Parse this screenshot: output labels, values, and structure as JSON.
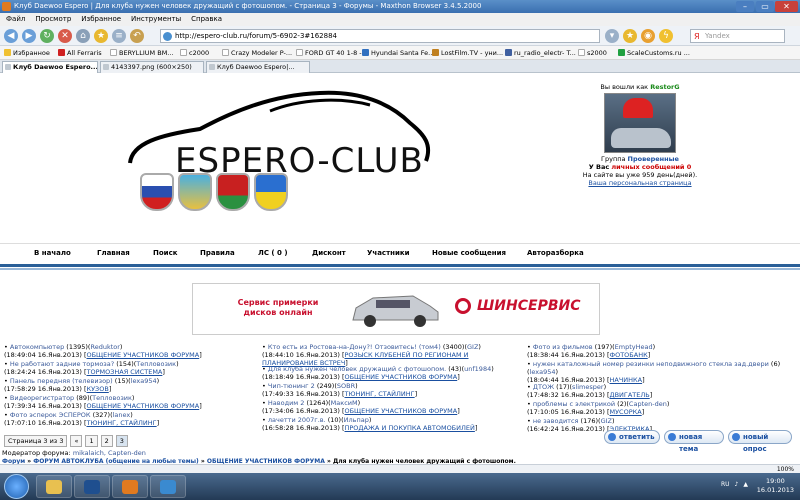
{
  "window": {
    "title": "Клуб Daewoo Espero | Для клуба нужен человек дружащий с фотошопом. - Страница 3 - Форумы - Maxthon Browser 3.4.5.2000"
  },
  "menu": [
    "Файл",
    "Просмотр",
    "Избранное",
    "Инструменты",
    "Справка"
  ],
  "navbar": {
    "url": "http://espero-club.ru/forum/5-6902-3#162884",
    "search_placeholder": "Yandex"
  },
  "bookmarks": [
    {
      "label": "Избранное",
      "color": "#f0c030"
    },
    {
      "label": "All Ferraris",
      "color": "#d02020"
    },
    {
      "label": "BERYLLIUM BM...",
      "color": "#ffffff"
    },
    {
      "label": "c2000",
      "color": "#ffffff"
    },
    {
      "label": "Crazy Modeler P-...",
      "color": "#ffffff"
    },
    {
      "label": "FORD GT 40 1-8 -...",
      "color": "#ffffff"
    },
    {
      "label": "Hyundai Santa Fe...",
      "color": "#3070c0"
    },
    {
      "label": "LostFilm.TV - уни...",
      "color": "#c08020"
    },
    {
      "label": "ru_radio_electr- T...",
      "color": "#4060a0"
    },
    {
      "label": "s2000",
      "color": "#ffffff"
    },
    {
      "label": "ScaleCustoms.ru ...",
      "color": "#20a040"
    }
  ],
  "tabs": [
    {
      "label": "Клуб Daewoo Espero...",
      "active": true
    },
    {
      "label": "4143397.png (600×250)",
      "active": false
    },
    {
      "label": "Клуб Daewoo Espero|...",
      "active": false
    }
  ],
  "logo": {
    "text": "ESPERO-CLUB"
  },
  "user": {
    "logged_in_as": "Вы вошли как",
    "username": "RestorG",
    "group_label": "Группа",
    "group": "Проверенные",
    "messages_prefix": "У Вас",
    "messages_link": "личных сообщений 0",
    "on_site": "На сайте вы уже 959 день(дней).",
    "personal_page": "Ваша персональная страница"
  },
  "mainnav": [
    "В начало",
    "Главная",
    "Поиск",
    "Правила",
    "ЛС ( 0 )",
    "Дисконт",
    "Участники",
    "Новые сообщения",
    "Авторазборка"
  ],
  "banner": {
    "left_line1": "Сервис примерки",
    "left_line2": "дисков онлайн",
    "brand": "ШИНСЕРВИС"
  },
  "forum_col1": [
    {
      "title": "Автокомпьютер",
      "count": "(1395)",
      "user": "Reduktor",
      "date": "(18:49:04 16.Янв.2013)",
      "section": "ОБЩЕНИЕ УЧАСТНИКОВ ФОРУМА"
    },
    {
      "title": "Не работают задние тормоза?",
      "count": "(154)",
      "user": "Тепловозик",
      "date": "(18:24:24 16.Янв.2013)",
      "section": "ТОРМОЗНАЯ СИСТЕМА"
    },
    {
      "title": "Панель передняя (телевизор)",
      "count": "(15)",
      "user": "lexa954",
      "date": "(17:58:29 16.Янв.2013)",
      "section": "КУЗОВ"
    },
    {
      "title": "Видеорегистратор",
      "count": "(89)",
      "user": "Тепловозик",
      "date": "(17:39:34 16.Янв.2013)",
      "section": "ОБЩЕНИЕ УЧАСТНИКОВ ФОРУМА"
    },
    {
      "title": "Фото эсперок ЭСПЕРОК",
      "count": "(327)",
      "user": "lanex",
      "date": "(17:07:10 16.Янв.2013)",
      "section": "ТЮНИНГ, СТАЙЛИНГ"
    }
  ],
  "forum_col2": [
    {
      "title": "Кто есть из Ростова-на-Дону?! Отзовитесь! (том4)",
      "count": "(3400)",
      "user": "GIZ",
      "date": "(18:44:10 16.Янв.2013)",
      "section": "РОЗЫСК КЛУБЕНЕЙ ПО РЕГИОНАМ И ПЛАНИРОВАНИЕ ВСТРЕЧ"
    },
    {
      "title": "Для клуба нужен человек дружащий с фотошопом.",
      "count": "(43)",
      "user": "unf1984",
      "date": "(18:18:49 16.Янв.2013)",
      "section": "ОБЩЕНИЕ УЧАСТНИКОВ ФОРУМА"
    },
    {
      "title": "Чип-тюнинг 2",
      "count": "(249)",
      "user": "SOBR",
      "date": "(17:49:33 16.Янв.2013)",
      "section": "ТЮНИНГ, СТАЙЛИНГ"
    },
    {
      "title": "Наводим 2",
      "count": "(1264)",
      "user": "МаксиМ",
      "date": "(17:34:06 16.Янв.2013)",
      "section": "ОБЩЕНИЕ УЧАСТНИКОВ ФОРУМА"
    },
    {
      "title": "лачетти 2007г.в.",
      "count": "(10)",
      "user": "Ильпар",
      "date": "(16:58:28 16.Янв.2013)",
      "section": "ПРОДАЖА И ПОКУПКА АВТОМОБИЛЕЙ"
    }
  ],
  "forum_col3": [
    {
      "title": "Фото из фильмов",
      "count": "(197)",
      "user": "EmptyHead",
      "date": "(18:38:44 16.Янв.2013)",
      "section": "ФОТОБАНК"
    },
    {
      "title": "нужен каталожный номер резинки неподвижного стекла зад.двери",
      "count": "(6)",
      "user": "lexa954",
      "date": "(18:04:44 16.Янв.2013)",
      "section": "НАЧИНКА"
    },
    {
      "title": "ДТОЖ",
      "count": "(17)",
      "user": "slimesper",
      "date": "(17:48:32 16.Янв.2013)",
      "section": "ДВИГАТЕЛЬ"
    },
    {
      "title": "проблемы с электрикой",
      "count": "(2)",
      "user": "Capten-den",
      "date": "(17:10:05 16.Янв.2013)",
      "section": "МУСОРКА"
    },
    {
      "title": "не заводится",
      "count": "(176)",
      "user": "GIZ",
      "date": "(16:42:24 16.Янв.2013)",
      "section": "ЭЛЕКТРИКА"
    }
  ],
  "pager": {
    "label": "Страница 3 из 3",
    "prev": "«",
    "pages": [
      "1",
      "2",
      "3"
    ]
  },
  "actions": {
    "reply": "ответить",
    "new_topic": "новая тема",
    "new_poll": "новый опрос"
  },
  "moderators": {
    "label": "Модератор форума:",
    "names": "mikalaich, Capten-den"
  },
  "breadcrumbs": {
    "forum": "Форум",
    "club": "ФОРУМ АВТОКЛУБА (общение на любые темы)",
    "section": "ОБЩЕНИЕ УЧАСТНИКОВ ФОРУМА",
    "topic": "Для клуба нужен человек дружащий с фотошопом."
  },
  "status": {
    "zoom": "100%"
  },
  "taskbar": {
    "time": "19:00",
    "date": "16.01.2013",
    "lang": "RU"
  }
}
